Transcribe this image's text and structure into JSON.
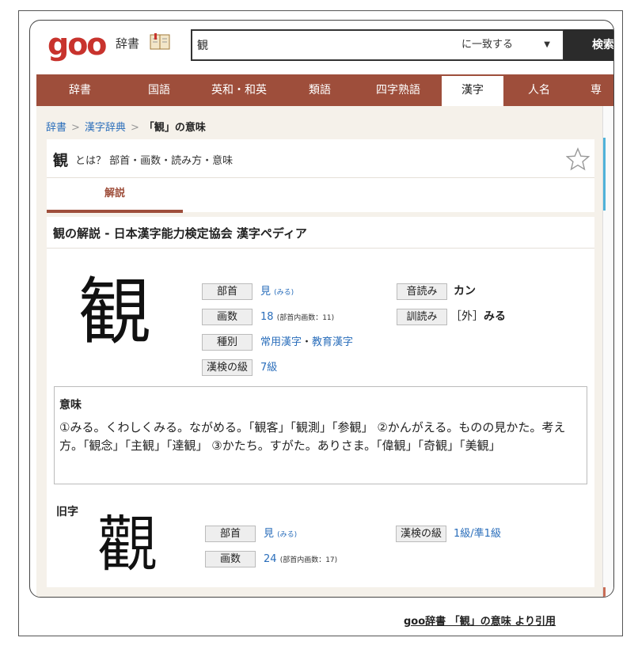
{
  "header": {
    "logo": "goo",
    "dict_label": "辞書",
    "search_value": "観",
    "match_option": "に一致する",
    "search_button": "検索"
  },
  "nav": {
    "items": [
      {
        "label": "辞書"
      },
      {
        "label": "国語"
      },
      {
        "label": "英和・和英"
      },
      {
        "label": "類語"
      },
      {
        "label": "四字熟語"
      },
      {
        "label": "漢字"
      },
      {
        "label": "人名"
      },
      {
        "label": "専"
      }
    ],
    "active": "漢字"
  },
  "breadcrumb": {
    "items": [
      "辞書",
      "漢字辞典"
    ],
    "current": "「観」の意味"
  },
  "title": {
    "kanji": "観",
    "rest": "とは？ 部首・画数・読み方・意味"
  },
  "tab": {
    "label": "解説"
  },
  "panel": {
    "heading": "観の解説 - 日本漢字能力検定協会 漢字ペディア",
    "kanji": "観",
    "info": {
      "bushu_label": "部首",
      "bushu_value": "見",
      "bushu_reading": "(みる)",
      "kakusu_label": "画数",
      "kakusu_value": "18",
      "kakusu_note": "(部首内画数：11)",
      "shubetsu_label": "種別",
      "shubetsu_value1": "常用漢字",
      "shubetsu_dot": "・",
      "shubetsu_value2": "教育漢字",
      "kyu_label": "漢検の級",
      "kyu_value": "7級",
      "on_label": "音読み",
      "on_value": "カン",
      "kun_label": "訓読み",
      "kun_prefix": "［外］",
      "kun_value": "みる"
    },
    "meaning": {
      "title": "意味",
      "text": "①みる。くわしくみる。ながめる。「観客」「観測」「参観」 ②かんがえる。ものの見かた。考え方。「観念」「主観」「達観」 ③かたち。すがた。ありさま。「偉観」「奇観」「美観」"
    },
    "old_form": {
      "title": "旧字",
      "kanji": "觀",
      "bushu_label": "部首",
      "bushu_value": "見",
      "bushu_reading": "(みる)",
      "kakusu_label": "画数",
      "kakusu_value": "24",
      "kakusu_note": "(部首内画数：17)",
      "kyu_label": "漢検の級",
      "kyu_value1": "1級",
      "kyu_sep": "/",
      "kyu_value2": "準1級"
    }
  },
  "citation": "goo辞書 「観」の意味 より引用",
  "colors": {
    "brand": "#c8332d",
    "nav": "#9e4e3b",
    "link": "#2a6ebb",
    "content_bg": "#f5f1ea"
  }
}
